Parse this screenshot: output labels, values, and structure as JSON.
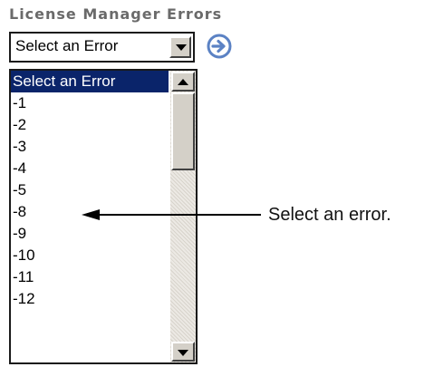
{
  "title": "License Manager Errors",
  "select": {
    "selected_value": "Select an Error"
  },
  "go_button": {
    "icon": "circle-arrow-right-icon",
    "color": "#5b82c4"
  },
  "list": {
    "items": [
      {
        "label": "Select an Error",
        "selected": true
      },
      {
        "label": "-1"
      },
      {
        "label": "-2"
      },
      {
        "label": "-3"
      },
      {
        "label": "-4"
      },
      {
        "label": "-5"
      },
      {
        "label": "-8"
      },
      {
        "label": "-9"
      },
      {
        "label": "-10"
      },
      {
        "label": "-11"
      },
      {
        "label": "-12"
      }
    ],
    "highlight_color": "#0a246a"
  },
  "callout": {
    "text": "Select an error."
  }
}
